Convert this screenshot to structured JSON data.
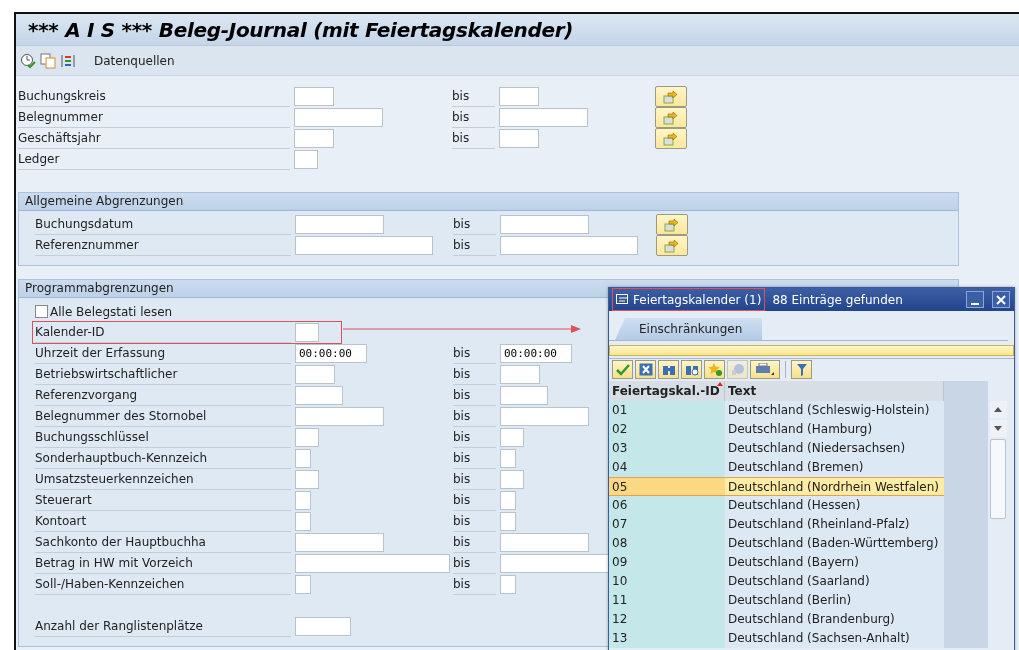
{
  "window": {
    "title": "*** A I S *** Beleg-Journal (mit Feiertagskalender)"
  },
  "toolbar": {
    "buttons": [
      {
        "kind": "execute"
      },
      {
        "kind": "variant"
      },
      {
        "kind": "list"
      }
    ],
    "label": "Datenquellen"
  },
  "top_rows": [
    {
      "label": "Buchungskreis",
      "from": {
        "kind": "short"
      },
      "to": {
        "kind": "short"
      },
      "bis": "bis",
      "multi": true
    },
    {
      "label": "Belegnummer",
      "from": {
        "kind": "long"
      },
      "to": {
        "kind": "long"
      },
      "bis": "bis",
      "multi": true
    },
    {
      "label": "Geschäftsjahr",
      "from": {
        "kind": "short"
      },
      "to": {
        "kind": "short"
      },
      "bis": "bis",
      "multi": true
    },
    {
      "label": "Ledger",
      "from": {
        "kind": "small"
      },
      "multi": false
    }
  ],
  "sections": [
    {
      "title": "Allgemeine Abgrenzungen",
      "rows": [
        {
          "kind": "range",
          "label": "Buchungsdatum",
          "from": {
            "kind": "long"
          },
          "to": {
            "kind": "long"
          },
          "bis": "bis",
          "multi": true
        },
        {
          "kind": "range",
          "label": "Referenznummer",
          "from": {
            "kind": "wide"
          },
          "to": {
            "kind": "wide"
          },
          "bis": "bis",
          "multi": true
        }
      ]
    },
    {
      "title": "Programmabgrenzungen",
      "rows": [
        {
          "kind": "checkbox",
          "label": "Alle Belegstati lesen",
          "checked": false
        },
        {
          "kind": "range",
          "label": "Kalender-ID",
          "from": {
            "kind": "small"
          },
          "highlighted": true,
          "arrow": true
        },
        {
          "kind": "range",
          "label": "Uhrzeit der Erfassung",
          "from": {
            "kind": "time",
            "value": "00:00:00"
          },
          "to": {
            "kind": "time",
            "value": "00:00:00"
          },
          "bis": "bis"
        },
        {
          "kind": "range",
          "label": "Betriebswirtschaftlicher",
          "from": {
            "kind": "short"
          },
          "to": {
            "kind": "short"
          },
          "bis": "bis"
        },
        {
          "kind": "range",
          "label": "Referenzvorgang",
          "from": {
            "kind": "medium"
          },
          "to": {
            "kind": "medium"
          },
          "bis": "bis"
        },
        {
          "kind": "range",
          "label": "Belegnummer des Stornobel",
          "from": {
            "kind": "long"
          },
          "to": {
            "kind": "long"
          },
          "bis": "bis"
        },
        {
          "kind": "range",
          "label": "Buchungsschlüssel",
          "from": {
            "kind": "small"
          },
          "to": {
            "kind": "small"
          },
          "bis": "bis"
        },
        {
          "kind": "range",
          "label": "Sonderhauptbuch-Kennzeich",
          "from": {
            "kind": "tiny"
          },
          "to": {
            "kind": "tiny"
          },
          "bis": "bis"
        },
        {
          "kind": "range",
          "label": "Umsatzsteuerkennzeichen",
          "from": {
            "kind": "small"
          },
          "to": {
            "kind": "small"
          },
          "bis": "bis"
        },
        {
          "kind": "range",
          "label": "Steuerart",
          "from": {
            "kind": "tiny"
          },
          "to": {
            "kind": "tiny"
          },
          "bis": "bis"
        },
        {
          "kind": "range",
          "label": "Kontoart",
          "from": {
            "kind": "tiny"
          },
          "to": {
            "kind": "tiny"
          },
          "bis": "bis"
        },
        {
          "kind": "range",
          "label": "Sachkonto der Hauptbuchha",
          "from": {
            "kind": "long"
          },
          "to": {
            "kind": "long"
          },
          "bis": "bis"
        },
        {
          "kind": "range",
          "label": "Betrag in HW mit Vorzeich",
          "from": {
            "kind": "xwide"
          },
          "to": {
            "kind": "xwide"
          },
          "bis": "bis"
        },
        {
          "kind": "range",
          "label": "Soll-/Haben-Kennzeichen",
          "from": {
            "kind": "tiny"
          },
          "to": {
            "kind": "tiny"
          },
          "bis": "bis"
        },
        {
          "kind": "spacer"
        },
        {
          "kind": "range",
          "label": "Anzahl der Ranglistenplätze",
          "from": {
            "kind": "count"
          }
        }
      ]
    }
  ],
  "popup": {
    "title": "Feiertagskalender (1)",
    "title_highlighted": true,
    "subtitle": "88 Einträge gefunden",
    "tabs": [
      {
        "label": "Einschränkungen",
        "selected": true
      }
    ],
    "tools": [
      {
        "kind": "check"
      },
      {
        "kind": "cancel"
      },
      {
        "kind": "find"
      },
      {
        "kind": "find-next"
      },
      {
        "kind": "favorite"
      },
      {
        "kind": "help",
        "disabled": true
      },
      {
        "kind": "print"
      },
      {
        "kind": "filter"
      }
    ],
    "columns": [
      "Feiertagskal.-ID",
      "Text"
    ],
    "rows": [
      {
        "id": "01",
        "text": "Deutschland (Schleswig-Holstein)",
        "selected": false
      },
      {
        "id": "02",
        "text": "Deutschland (Hamburg)",
        "selected": false
      },
      {
        "id": "03",
        "text": "Deutschland (Niedersachsen)",
        "selected": false
      },
      {
        "id": "04",
        "text": "Deutschland (Bremen)",
        "selected": false
      },
      {
        "id": "05",
        "text": "Deutschland (Nordrhein Westfalen)",
        "selected": true
      },
      {
        "id": "06",
        "text": "Deutschland (Hessen)",
        "selected": false
      },
      {
        "id": "07",
        "text": "Deutschland (Rheinland-Pfalz)",
        "selected": false
      },
      {
        "id": "08",
        "text": "Deutschland (Baden-Württemberg)",
        "selected": false
      },
      {
        "id": "09",
        "text": "Deutschland (Bayern)",
        "selected": false
      },
      {
        "id": "10",
        "text": "Deutschland (Saarland)",
        "selected": false
      },
      {
        "id": "11",
        "text": "Deutschland (Berlin)",
        "selected": false
      },
      {
        "id": "12",
        "text": "Deutschland (Brandenburg)",
        "selected": false
      },
      {
        "id": "13",
        "text": "Deutschland (Sachsen-Anhalt)",
        "selected": false
      }
    ]
  }
}
